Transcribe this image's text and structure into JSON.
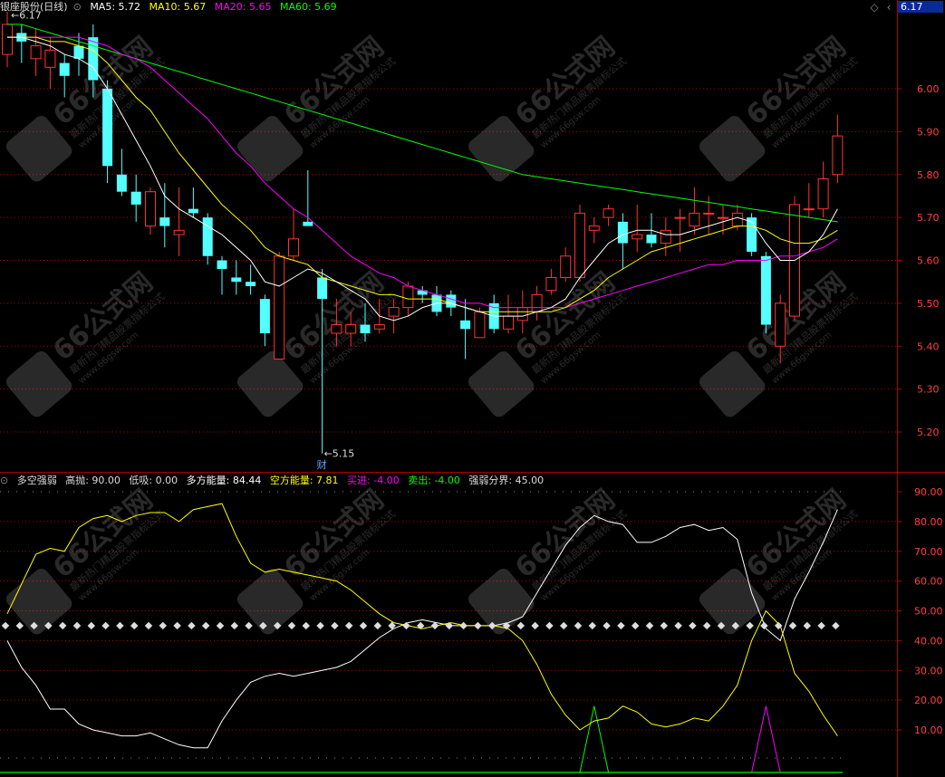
{
  "main_header": {
    "stock_name": "银座股份(日线)",
    "ma5": "MA5: 5.72",
    "ma10": "MA10: 5.67",
    "ma20": "MA20: 5.65",
    "ma60": "MA60: 5.69"
  },
  "top_right": {
    "current_price": "6.17"
  },
  "price_axis": [
    "6.00",
    "5.90",
    "5.80",
    "5.70",
    "5.60",
    "5.50",
    "5.40",
    "5.30",
    "5.20"
  ],
  "max_label": "6.17",
  "min_label": "5.15",
  "fin_marker": "财",
  "sub_header": {
    "name": "多空强弱",
    "gaopao": "高抛: 90.00",
    "dixi": "低吸: 0.00",
    "duofang": "多方能量: 84.44",
    "kongfang": "空方能量: 7.81",
    "mairu": "买进: -4.00",
    "maichu": "卖出: -4.00",
    "fenjie": "强弱分界: 45.00"
  },
  "sub_axis": [
    "90.00",
    "80.00",
    "70.00",
    "60.00",
    "50.00",
    "40.00",
    "30.00",
    "20.00",
    "10.00"
  ],
  "watermark": {
    "brand": "66公式网",
    "sub": "最新热门精品股票指标公式",
    "url": "www.66gsw.com"
  },
  "colors": {
    "up": "#ff3232",
    "down": "#54ffff",
    "ma5": "#ffffff",
    "ma10": "#ffff00",
    "ma20": "#ff00ff",
    "ma60": "#00ff00",
    "grid": "#b00000",
    "axis_text": "#ff4040"
  },
  "chart_data": [
    {
      "type": "candlestick",
      "title": "银座股份(日线)",
      "ylim": [
        5.12,
        6.2
      ],
      "candles": [
        [
          6.08,
          6.15,
          6.18,
          6.05
        ],
        [
          6.13,
          6.11,
          6.15,
          6.06
        ],
        [
          6.07,
          6.1,
          6.14,
          6.03
        ],
        [
          6.05,
          6.09,
          6.12,
          6.0
        ],
        [
          6.06,
          6.03,
          6.08,
          5.98
        ],
        [
          6.1,
          6.07,
          6.13,
          6.03
        ],
        [
          6.12,
          6.02,
          6.15,
          5.98
        ],
        [
          6.0,
          5.82,
          6.02,
          5.78
        ],
        [
          5.8,
          5.76,
          5.86,
          5.75
        ],
        [
          5.76,
          5.73,
          5.8,
          5.69
        ],
        [
          5.68,
          5.76,
          5.77,
          5.66
        ],
        [
          5.7,
          5.68,
          5.78,
          5.63
        ],
        [
          5.66,
          5.67,
          5.77,
          5.61
        ],
        [
          5.72,
          5.71,
          5.77,
          5.7
        ],
        [
          5.7,
          5.61,
          5.71,
          5.59
        ],
        [
          5.6,
          5.58,
          5.61,
          5.52
        ],
        [
          5.56,
          5.55,
          5.6,
          5.52
        ],
        [
          5.55,
          5.54,
          5.59,
          5.52
        ],
        [
          5.51,
          5.43,
          5.52,
          5.4
        ],
        [
          5.37,
          5.61,
          5.62,
          5.37
        ],
        [
          5.61,
          5.65,
          5.72,
          5.6
        ],
        [
          5.69,
          5.68,
          5.81,
          5.68
        ],
        [
          5.56,
          5.51,
          5.58,
          5.15
        ],
        [
          5.43,
          5.45,
          5.51,
          5.4
        ],
        [
          5.43,
          5.45,
          5.48,
          5.4
        ],
        [
          5.45,
          5.43,
          5.5,
          5.41
        ],
        [
          5.44,
          5.45,
          5.51,
          5.43
        ],
        [
          5.47,
          5.49,
          5.51,
          5.43
        ],
        [
          5.49,
          5.54,
          5.55,
          5.47
        ],
        [
          5.53,
          5.52,
          5.54,
          5.5
        ],
        [
          5.52,
          5.48,
          5.54,
          5.47
        ],
        [
          5.52,
          5.49,
          5.53,
          5.47
        ],
        [
          5.46,
          5.44,
          5.51,
          5.37
        ],
        [
          5.42,
          5.48,
          5.49,
          5.42
        ],
        [
          5.5,
          5.44,
          5.52,
          5.43
        ],
        [
          5.44,
          5.47,
          5.52,
          5.43
        ],
        [
          5.46,
          5.49,
          5.53,
          5.43
        ],
        [
          5.48,
          5.52,
          5.54,
          5.46
        ],
        [
          5.53,
          5.56,
          5.58,
          5.52
        ],
        [
          5.56,
          5.61,
          5.63,
          5.55
        ],
        [
          5.56,
          5.71,
          5.73,
          5.55
        ],
        [
          5.67,
          5.68,
          5.7,
          5.64
        ],
        [
          5.7,
          5.72,
          5.73,
          5.68
        ],
        [
          5.69,
          5.64,
          5.71,
          5.58
        ],
        [
          5.65,
          5.66,
          5.73,
          5.62
        ],
        [
          5.66,
          5.64,
          5.71,
          5.63
        ],
        [
          5.64,
          5.67,
          5.7,
          5.61
        ],
        [
          5.7,
          5.7,
          5.72,
          5.62
        ],
        [
          5.68,
          5.71,
          5.77,
          5.66
        ],
        [
          5.71,
          5.71,
          5.75,
          5.66
        ],
        [
          5.7,
          5.7,
          5.73,
          5.66
        ],
        [
          5.68,
          5.71,
          5.73,
          5.67
        ],
        [
          5.7,
          5.62,
          5.71,
          5.61
        ],
        [
          5.61,
          5.45,
          5.62,
          5.43
        ],
        [
          5.4,
          5.5,
          5.52,
          5.36
        ],
        [
          5.47,
          5.73,
          5.75,
          5.46
        ],
        [
          5.72,
          5.72,
          5.78,
          5.7
        ],
        [
          5.72,
          5.79,
          5.83,
          5.7
        ],
        [
          5.8,
          5.89,
          5.94,
          5.78
        ]
      ],
      "ma5": [
        6.12,
        6.12,
        6.11,
        6.1,
        6.08,
        6.07,
        6.05,
        6.0,
        5.94,
        5.88,
        5.82,
        5.75,
        5.72,
        5.7,
        5.68,
        5.66,
        5.63,
        5.6,
        5.55,
        5.54,
        5.56,
        5.58,
        5.57,
        5.55,
        5.53,
        5.51,
        5.47,
        5.46,
        5.47,
        5.49,
        5.5,
        5.5,
        5.49,
        5.48,
        5.47,
        5.47,
        5.47,
        5.48,
        5.49,
        5.51,
        5.56,
        5.6,
        5.64,
        5.66,
        5.67,
        5.67,
        5.66,
        5.66,
        5.67,
        5.68,
        5.69,
        5.7,
        5.69,
        5.64,
        5.6,
        5.6,
        5.62,
        5.66,
        5.72
      ],
      "ma10": [
        6.12,
        6.12,
        6.12,
        6.11,
        6.11,
        6.1,
        6.09,
        6.06,
        6.02,
        5.98,
        5.95,
        5.9,
        5.85,
        5.81,
        5.77,
        5.73,
        5.7,
        5.67,
        5.63,
        5.61,
        5.6,
        5.59,
        5.56,
        5.55,
        5.54,
        5.53,
        5.52,
        5.52,
        5.51,
        5.51,
        5.51,
        5.5,
        5.49,
        5.48,
        5.48,
        5.48,
        5.48,
        5.48,
        5.48,
        5.49,
        5.51,
        5.53,
        5.56,
        5.58,
        5.6,
        5.62,
        5.63,
        5.64,
        5.65,
        5.66,
        5.67,
        5.68,
        5.68,
        5.67,
        5.65,
        5.64,
        5.64,
        5.65,
        5.67
      ],
      "ma20": [
        6.12,
        6.12,
        6.12,
        6.12,
        6.12,
        6.12,
        6.11,
        6.1,
        6.08,
        6.07,
        6.05,
        6.02,
        5.99,
        5.96,
        5.93,
        5.89,
        5.85,
        5.82,
        5.78,
        5.75,
        5.72,
        5.7,
        5.67,
        5.64,
        5.61,
        5.59,
        5.57,
        5.56,
        5.54,
        5.53,
        5.52,
        5.51,
        5.5,
        5.5,
        5.49,
        5.49,
        5.49,
        5.49,
        5.49,
        5.49,
        5.5,
        5.51,
        5.52,
        5.53,
        5.54,
        5.55,
        5.56,
        5.57,
        5.58,
        5.59,
        5.59,
        5.6,
        5.6,
        5.6,
        5.61,
        5.61,
        5.62,
        5.63,
        5.65
      ],
      "ma60": [
        6.15,
        6.15,
        6.14,
        6.13,
        6.12,
        6.11,
        6.1,
        6.09,
        6.08,
        6.07,
        6.06,
        6.05,
        6.04,
        6.03,
        6.02,
        6.01,
        6.0,
        5.99,
        5.98,
        5.97,
        5.96,
        5.95,
        5.94,
        5.93,
        5.92,
        5.91,
        5.9,
        5.89,
        5.88,
        5.87,
        5.86,
        5.85,
        5.84,
        5.83,
        5.82,
        5.81,
        5.8,
        5.795,
        5.79,
        5.785,
        5.78,
        5.775,
        5.77,
        5.765,
        5.76,
        5.755,
        5.75,
        5.745,
        5.74,
        5.735,
        5.73,
        5.725,
        5.72,
        5.715,
        5.71,
        5.705,
        5.7,
        5.695,
        5.69
      ]
    },
    {
      "type": "line",
      "title": "多空强弱",
      "ylim": [
        0,
        95
      ],
      "series": [
        {
          "name": "多方能量",
          "values": [
            40,
            31,
            25,
            17,
            17,
            12,
            10,
            9,
            8,
            8,
            9,
            7,
            5,
            4,
            4,
            13,
            20,
            26,
            28,
            29,
            28,
            29,
            30,
            31,
            33,
            37,
            41,
            44,
            46,
            47,
            46,
            45,
            45,
            45,
            45,
            46,
            48,
            56,
            64,
            72,
            78,
            82,
            80,
            79,
            73,
            73,
            75,
            78,
            79,
            77,
            78,
            74,
            56,
            44,
            40,
            54,
            63,
            73,
            84
          ]
        },
        {
          "name": "空方能量",
          "values": [
            49,
            59,
            69,
            71,
            70,
            78,
            81,
            82,
            80,
            82,
            83,
            83,
            80,
            84,
            85,
            86,
            75,
            66,
            63,
            64,
            63,
            62,
            61,
            60,
            57,
            53,
            49,
            46,
            45,
            44,
            45,
            46,
            45,
            45,
            45,
            44,
            40,
            32,
            22,
            15,
            10,
            13,
            14,
            18,
            16,
            12,
            11,
            12,
            14,
            13,
            18,
            25,
            40,
            50,
            45,
            29,
            23,
            15,
            8
          ]
        },
        {
          "name": "强弱分界",
          "values": [
            45
          ]
        },
        {
          "name": "买进",
          "values": [
            0,
            0,
            0,
            0,
            0,
            0,
            0,
            0,
            0,
            0,
            0,
            0,
            0,
            0,
            0,
            0,
            0,
            0,
            0,
            0,
            0,
            0,
            0,
            0,
            0,
            0,
            0,
            0,
            0,
            0,
            0,
            0,
            0,
            0,
            0,
            0,
            0,
            0,
            0,
            0,
            0,
            18,
            0,
            0,
            0,
            0,
            0,
            0,
            0,
            0,
            0,
            0,
            0,
            0,
            0,
            0,
            0,
            0,
            0
          ]
        },
        {
          "name": "卖出",
          "values": [
            0,
            0,
            0,
            0,
            0,
            0,
            0,
            0,
            0,
            0,
            0,
            0,
            0,
            0,
            0,
            0,
            0,
            0,
            0,
            0,
            0,
            0,
            0,
            0,
            0,
            0,
            0,
            0,
            0,
            0,
            0,
            0,
            0,
            0,
            0,
            0,
            0,
            0,
            0,
            0,
            0,
            0,
            0,
            0,
            0,
            0,
            0,
            0,
            0,
            0,
            0,
            0,
            0,
            18,
            0,
            0,
            0,
            0,
            0
          ]
        }
      ]
    }
  ]
}
